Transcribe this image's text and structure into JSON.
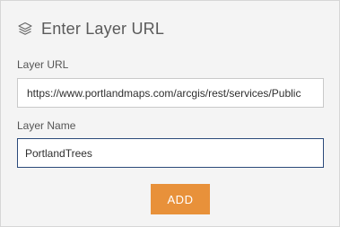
{
  "dialog": {
    "title": "Enter Layer URL",
    "title_icon": "layers-icon"
  },
  "form": {
    "url_label": "Layer URL",
    "url_value": "https://www.portlandmaps.com/arcgis/rest/services/Public",
    "name_label": "Layer Name",
    "name_value": "PortlandTrees"
  },
  "actions": {
    "add_label": "ADD"
  },
  "colors": {
    "panel_background": "#f4f4f4",
    "button_accent": "#e8913a",
    "focused_input_border": "#2b4a7a",
    "title_text": "#5a5a5a"
  }
}
